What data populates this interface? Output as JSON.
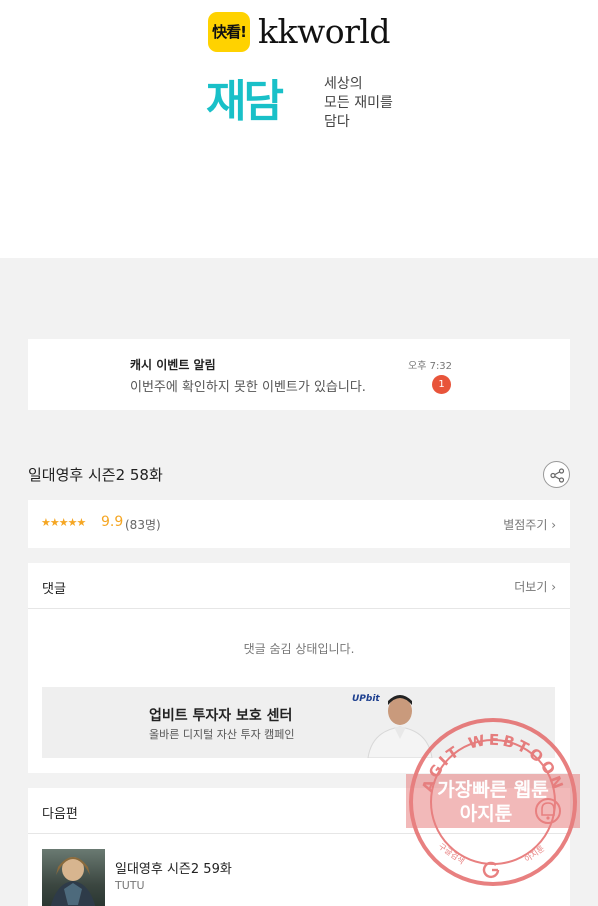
{
  "header": {
    "kk_logo_text": "快看!",
    "kk_wordmark": "kkworld",
    "jaedam_logo": "재담",
    "jaedam_tagline": [
      "세상의",
      "모든 재미를",
      "담다"
    ]
  },
  "notice": {
    "title": "캐시 이벤트 알림",
    "body": "이번주에 확인하지 못한 이벤트가 있습니다.",
    "time": "오후 7:32",
    "badge_count": "1"
  },
  "episode": {
    "title": "일대영후 시즌2 58화",
    "share_icon": "share-icon"
  },
  "rating": {
    "stars": "★★★★★",
    "score": "9.9",
    "count": "(83명)",
    "rate_link": "별점주기 ›"
  },
  "comments": {
    "header": "댓글",
    "more": "더보기 ›",
    "hidden_message": "댓글 숨김 상태입니다."
  },
  "ad": {
    "title": "업비트 투자자 보호 센터",
    "subtitle": "올바른 디지털 자산 투자 캠페인",
    "brand": "UPbit"
  },
  "next": {
    "header": "다음편",
    "title": "일대영후 시즌2 59화",
    "author": "TUTU"
  },
  "watermark": {
    "ring_text": "AGIT WEBTOON",
    "line1": "가장빠른 웹툰",
    "line2": "아지툰",
    "bottom_left": "구글검색",
    "bottom_right": "아지툰",
    "color": "#e46a6a"
  }
}
